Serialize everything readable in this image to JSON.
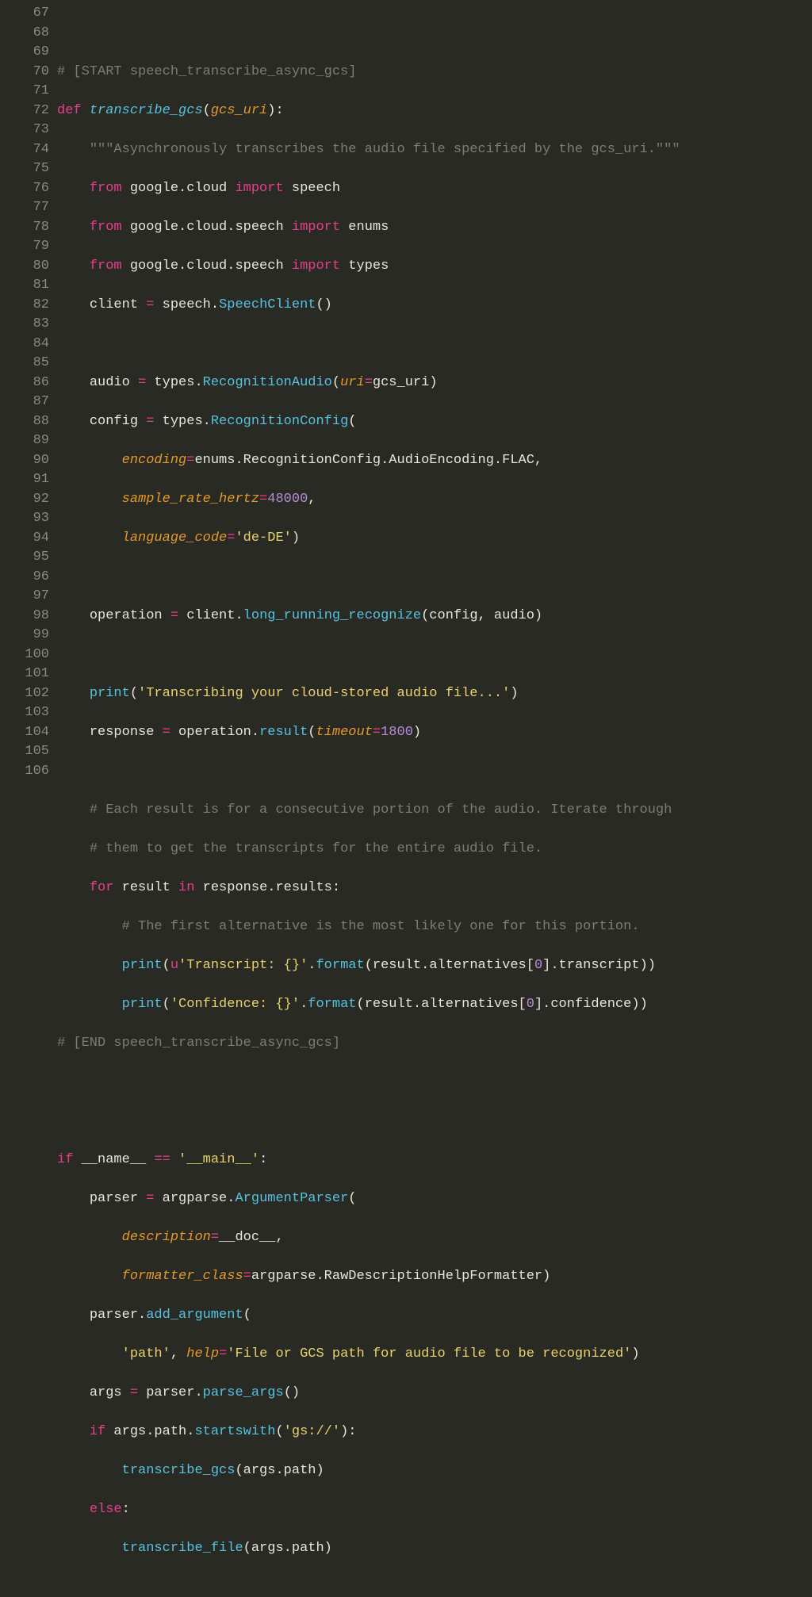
{
  "line_numbers": [
    "67",
    "68",
    "69",
    "70",
    "71",
    "72",
    "73",
    "74",
    "75",
    "76",
    "77",
    "78",
    "79",
    "80",
    "81",
    "82",
    "83",
    "84",
    "85",
    "86",
    "87",
    "88",
    "89",
    "90",
    "91",
    "92",
    "93",
    "94",
    "95",
    "96",
    "97",
    "98",
    "99",
    "100",
    "101",
    "102",
    "103",
    "104",
    "105",
    "106"
  ],
  "l67": "",
  "l68_comment": "# [START speech_transcribe_async_gcs]",
  "l69_def": "def",
  "l69_fn": "transcribe_gcs",
  "l69_arg": "gcs_uri",
  "l70_doc": "\"\"\"Asynchronously transcribes the audio file specified by the gcs_uri.\"\"\"",
  "l71_from": "from",
  "l71_mod": "google.cloud",
  "l71_import": "import",
  "l71_name": "speech",
  "l72_from": "from",
  "l72_mod": "google.cloud.speech",
  "l72_import": "import",
  "l72_name": "enums",
  "l73_from": "from",
  "l73_mod": "google.cloud.speech",
  "l73_import": "import",
  "l73_name": "types",
  "l74_lhs": "client ",
  "l74_eq": "=",
  "l74_obj": " speech.",
  "l74_call": "SpeechClient",
  "l74_tail": "()",
  "l76_lhs": "audio ",
  "l76_eq": "=",
  "l76_obj": " types.",
  "l76_call": "RecognitionAudio",
  "l76_kw": "uri",
  "l76_eq2": "=",
  "l76_val": "gcs_uri",
  "l77_lhs": "config ",
  "l77_eq": "=",
  "l77_obj": " types.",
  "l77_call": "RecognitionConfig",
  "l78_kw": "encoding",
  "l78_eq": "=",
  "l78_val": "enums.RecognitionConfig.AudioEncoding.FLAC,",
  "l79_kw": "sample_rate_hertz",
  "l79_eq": "=",
  "l79_num": "48000",
  "l79_tail": ",",
  "l80_kw": "language_code",
  "l80_eq": "=",
  "l80_str": "'de-DE'",
  "l80_tail": ")",
  "l82_lhs": "operation ",
  "l82_eq": "=",
  "l82_obj": " client.",
  "l82_call": "long_running_recognize",
  "l82_args": "(config, audio)",
  "l84_call": "print",
  "l84_str": "'Transcribing your cloud-stored audio file...'",
  "l85_lhs": "response ",
  "l85_eq": "=",
  "l85_obj": " operation.",
  "l85_call": "result",
  "l85_kw": "timeout",
  "l85_eq2": "=",
  "l85_num": "1800",
  "l87_comment": "# Each result is for a consecutive portion of the audio. Iterate through",
  "l88_comment": "# them to get the transcripts for the entire audio file.",
  "l89_for": "for",
  "l89_var": " result ",
  "l89_in": "in",
  "l89_iter": " response.results:",
  "l90_comment": "# The first alternative is the most likely one for this portion.",
  "l91_call": "print",
  "l91_u": "u",
  "l91_str": "'Transcript: {}'",
  "l91_fmt": ".",
  "l91_format": "format",
  "l91_arg1": "(result.alternatives[",
  "l91_idx": "0",
  "l91_arg2": "].transcript))",
  "l92_call": "print",
  "l92_str": "'Confidence: {}'",
  "l92_fmt": ".",
  "l92_format": "format",
  "l92_arg1": "(result.alternatives[",
  "l92_idx": "0",
  "l92_arg2": "].confidence))",
  "l93_comment": "# [END speech_transcribe_async_gcs]",
  "l96_if": "if",
  "l96_name": " __name__ ",
  "l96_eq": "==",
  "l96_str": " '__main__'",
  "l96_colon": ":",
  "l97_lhs": "parser ",
  "l97_eq": "=",
  "l97_obj": " argparse.",
  "l97_call": "ArgumentParser",
  "l97_tail": "(",
  "l98_kw": "description",
  "l98_eq": "=",
  "l98_val": "__doc__,",
  "l99_kw": "formatter_class",
  "l99_eq": "=",
  "l99_val": "argparse.RawDescriptionHelpFormatter)",
  "l100_obj": "parser.",
  "l100_call": "add_argument",
  "l100_tail": "(",
  "l101_str": "'path'",
  "l101_comma": ", ",
  "l101_kw": "help",
  "l101_eq": "=",
  "l101_str2": "'File or GCS path for audio file to be recognized'",
  "l101_tail": ")",
  "l102_lhs": "args ",
  "l102_eq": "=",
  "l102_obj": " parser.",
  "l102_call": "parse_args",
  "l102_tail": "()",
  "l103_if": "if",
  "l103_obj": " args.path.",
  "l103_call": "startswith",
  "l103_str": "'gs://'",
  "l103_tail": "):",
  "l104_call": "transcribe_gcs",
  "l104_args": "(args.path)",
  "l105_else": "else",
  "l105_colon": ":",
  "l106_call": "transcribe_file",
  "l106_args": "(args.path)"
}
